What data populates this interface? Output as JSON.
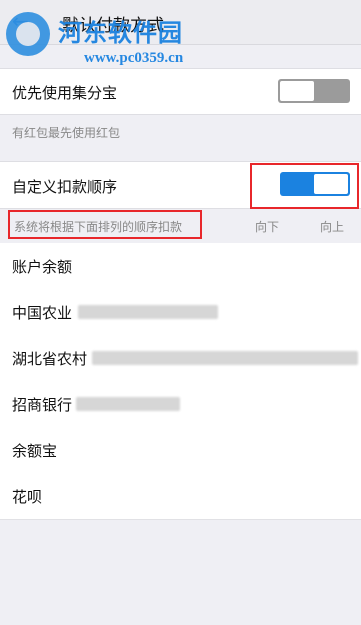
{
  "topbar": {
    "title": "默认付款方式",
    "back_icon": "back-arrow-icon"
  },
  "watermark": {
    "site_name": "河东软件园",
    "url": "www.pc0359.cn"
  },
  "prefer_section": {
    "label": "优先使用集分宝",
    "toggle_on": false,
    "note": "有红包最先使用红包"
  },
  "custom_order": {
    "label": "自定义扣款顺序",
    "toggle_on": true,
    "hint": "系统将根据下面排列的顺序扣款",
    "col_down": "向下",
    "col_up": "向上"
  },
  "accounts": [
    {
      "label": "账户余额"
    },
    {
      "label": "中国农业"
    },
    {
      "label": "湖北省农村"
    },
    {
      "label": "招商银行"
    },
    {
      "label": "余额宝"
    },
    {
      "label": "花呗"
    }
  ],
  "colors": {
    "accent": "#1b82e0",
    "highlight": "#e8272b",
    "background": "#efeff4"
  }
}
